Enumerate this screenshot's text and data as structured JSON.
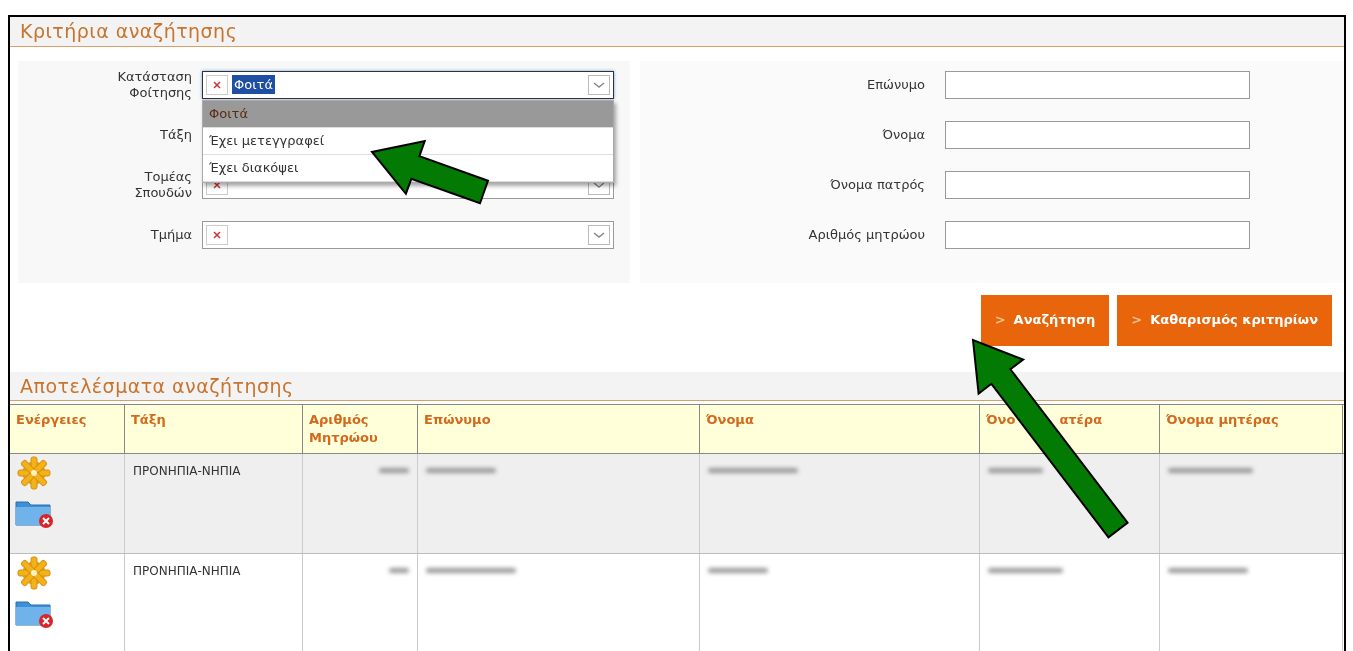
{
  "criteria": {
    "title": "Κριτήρια αναζήτησης",
    "left_fields": [
      {
        "label": "Κατάσταση Φοίτησης",
        "value": "Φοιτά",
        "open": true,
        "options": [
          {
            "label": "Φοιτά",
            "selected": true
          },
          {
            "label": "Έχει μετεγγραφεί",
            "selected": false
          },
          {
            "label": "Έχει διακόψει",
            "selected": false
          }
        ]
      },
      {
        "label": "Τάξη"
      },
      {
        "label": "Τομέας Σπουδών",
        "open": false
      },
      {
        "label": "Τμήμα",
        "open": false
      }
    ],
    "right_fields": [
      {
        "label": "Επώνυμο"
      },
      {
        "label": "Όνομα"
      },
      {
        "label": "Όνομα πατρός"
      },
      {
        "label": "Αριθμός μητρώου"
      }
    ],
    "buttons": [
      {
        "icon": ">",
        "label": "Αναζήτηση"
      },
      {
        "icon": ">",
        "label": "Καθαρισμός κριτηρίων"
      }
    ]
  },
  "results": {
    "title": "Αποτελέσματα αναζήτησης",
    "columns": [
      {
        "parts": [
          "Ενέργειες"
        ]
      },
      {
        "parts": [
          "Τάξη"
        ]
      },
      {
        "parts": [
          "Αριθμός Μητρώου"
        ]
      },
      {
        "parts": [
          "Επώνυμο"
        ]
      },
      {
        "parts": [
          "Όνομα"
        ]
      },
      {
        "parts": [
          "Όνο",
          "ατέρα"
        ]
      },
      {
        "parts": [
          "Όνομα μητέρας"
        ]
      }
    ],
    "rows": [
      {
        "class": "ΠΡΟΝΗΠΙΑ-ΝΗΠΙΑ",
        "shaded": true
      },
      {
        "class": "ΠΡΟΝΗΠΙΑ-ΝΗΠΙΑ",
        "shaded": false
      }
    ]
  }
}
